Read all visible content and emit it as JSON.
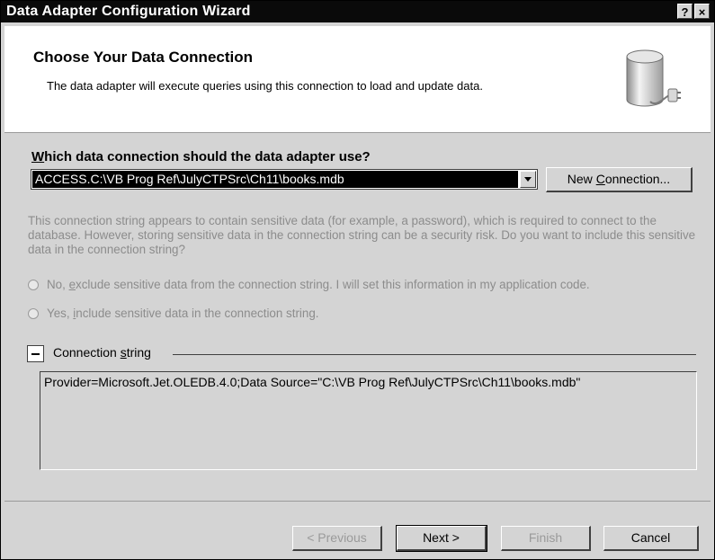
{
  "window": {
    "title": "Data Adapter Configuration Wizard",
    "help_glyph": "?",
    "close_glyph": "×"
  },
  "header": {
    "title": "Choose Your Data Connection",
    "subtitle": "The data adapter will execute queries using this connection to load and update data.",
    "icon": "database-plug-icon"
  },
  "connection": {
    "question_pre": "",
    "question_ak": "W",
    "question_post": "hich data connection should the data adapter use?",
    "selected": "ACCESS.C:\\VB Prog Ref\\JulyCTPSrc\\Ch11\\books.mdb",
    "new_conn_pre": "New ",
    "new_conn_ak": "C",
    "new_conn_post": "onnection..."
  },
  "sensitive": {
    "warning": "This connection string appears to contain sensitive data (for example, a password), which is required to connect to the database. However, storing sensitive data in the connection string can be a security risk. Do you want to include this sensitive data in the connection string?",
    "option_no_pre": "No, ",
    "option_no_ak": "e",
    "option_no_post": "xclude sensitive data from the connection string. I will set this information in my application code.",
    "option_yes_pre": "Yes, ",
    "option_yes_ak": "i",
    "option_yes_post": "nclude sensitive data in the connection string."
  },
  "connection_string": {
    "label_pre": "Connection ",
    "label_ak": "s",
    "label_post": "tring",
    "value": "Provider=Microsoft.Jet.OLEDB.4.0;Data Source=\"C:\\VB Prog Ref\\JulyCTPSrc\\Ch11\\books.mdb\""
  },
  "buttons": {
    "previous": "< Previous",
    "next": "Next >",
    "finish": "Finish",
    "cancel": "Cancel"
  }
}
